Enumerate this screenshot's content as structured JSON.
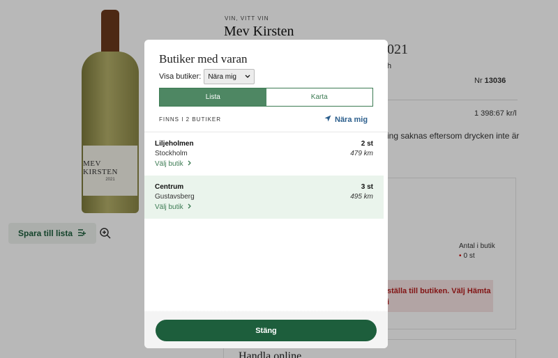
{
  "product": {
    "bottle_label": "MEV KIRSTEN",
    "bottle_year": "2021",
    "category": "VIN, VITT VIN",
    "name": "Mev Kirsten",
    "title_year_fragment": "021",
    "fragment_h": "h",
    "nr_label": "Nr",
    "nr_value": "13036",
    "price_per_liter": "1 398:67 kr/l",
    "info_fragment": "ing saknas eftersom drycken inte är",
    "save_label": "Spara till lista",
    "zoom_icon": "zoom-in-icon"
  },
  "stock_card": {
    "antal_label": "Antal i butik",
    "antal_value": "0 st",
    "warning": "ställa till butiken. Välj Hämta i"
  },
  "online_heading": "Handla online",
  "modal": {
    "title": "Butiker med varan",
    "visa_label": "Visa butiker:",
    "select_value": "Nära mig",
    "tabs": [
      {
        "label": "Lista",
        "active": true
      },
      {
        "label": "Karta",
        "active": false
      }
    ],
    "found_text": "FINNS I 2 BUTIKER",
    "near_me": "Nära mig",
    "stores": [
      {
        "name": "Liljeholmen",
        "count": "2 st",
        "city": "Stockholm",
        "distance": "479 km",
        "link": "Välj butik",
        "highlighted": false
      },
      {
        "name": "Centrum",
        "count": "3 st",
        "city": "Gustavsberg",
        "distance": "495 km",
        "link": "Välj butik",
        "highlighted": true
      }
    ],
    "close_label": "Stäng"
  },
  "colors": {
    "brand_green": "#1d5e3c",
    "tab_active": "#4e8763",
    "highlight_bg": "#eaf4ec",
    "link_blue": "#2b5e8c"
  }
}
